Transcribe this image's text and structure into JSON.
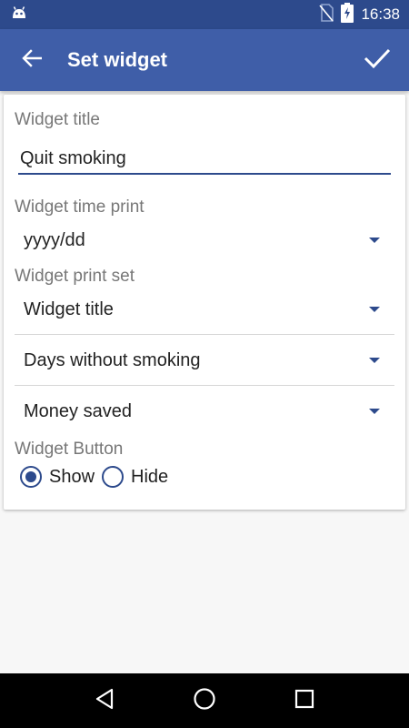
{
  "status_bar": {
    "time": "16:38",
    "icons": [
      "android-icon",
      "no-sim-icon",
      "battery-charging-icon"
    ]
  },
  "app_bar": {
    "title": "Set widget",
    "back_icon": "arrow-back-icon",
    "confirm_icon": "check-icon"
  },
  "form": {
    "widget_title_label": "Widget title",
    "widget_title_value": "Quit smoking",
    "time_print_label": "Widget time print",
    "time_print_value": "yyyy/dd",
    "print_set_label": "Widget print set",
    "print_set_items": [
      "Widget title",
      "Days without smoking",
      "Money saved"
    ],
    "button_label": "Widget Button",
    "button_options": [
      {
        "label": "Show",
        "selected": true
      },
      {
        "label": "Hide",
        "selected": false
      }
    ]
  },
  "colors": {
    "primary": "#3f5ea8",
    "primary_dark": "#2d4a8c",
    "accent": "#2d4a8c"
  },
  "nav_bar": {
    "icons": [
      "back-triangle-icon",
      "home-circle-icon",
      "recents-square-icon"
    ]
  }
}
